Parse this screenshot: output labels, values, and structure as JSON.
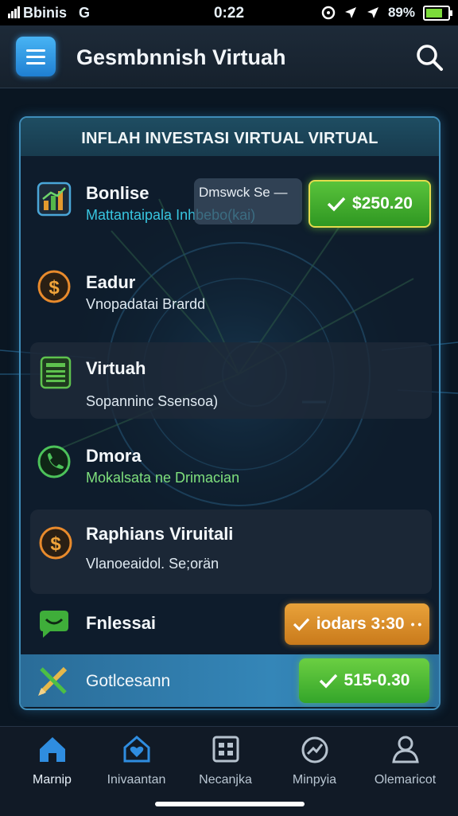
{
  "status_bar": {
    "carrier": "Bbinis",
    "network": "G",
    "time": "0:22",
    "battery": "89%",
    "battery_level": 0.89
  },
  "header": {
    "title": "Gesmbnnish Virtuah",
    "menu_icon": "hamburger-menu-icon",
    "search_icon": "search-icon"
  },
  "card": {
    "title": "INFLAH INVESTASI VIRTUAL VIRTUAL",
    "items": [
      {
        "title": "Bonlise",
        "subtitle": "Mattantaipala Inhbebo(kai)",
        "icon": "chart-icon",
        "tag": "Dmswck Se",
        "tag_suffix": "—",
        "action": "$250.20",
        "action_icon": "check-icon"
      },
      {
        "title": "Eadur",
        "subtitle": "Vnopadatai Brardd",
        "icon": "dollar-coin-icon"
      },
      {
        "title": "Virtuah",
        "subtitle": "Sopanninc Ssensoa)",
        "icon": "ledger-icon"
      },
      {
        "title": "Dmora",
        "subtitle": "Mokalsata ne Drimacian",
        "icon": "phone-icon"
      },
      {
        "title": "Raphians Viruitali",
        "subtitle": "Vlanoeaidol. Se;orän",
        "icon": "dollar-coin-icon"
      },
      {
        "title": "Fnlessai",
        "icon": "chat-bubble-icon",
        "action": "iodars 3:30",
        "action_suffix": "• •",
        "action_icon": "check-icon"
      },
      {
        "title": "Gotlcesann",
        "icon": "pencil-cross-icon",
        "action": "515-0.30",
        "action_icon": "check-icon"
      }
    ]
  },
  "nav": {
    "items": [
      {
        "label": "Marnip",
        "icon": "home-icon"
      },
      {
        "label": "Inivaantan",
        "icon": "house-heart-icon"
      },
      {
        "label": "Necanjka",
        "icon": "grid-box-icon"
      },
      {
        "label": "Minpyia",
        "icon": "chart-circle-icon"
      },
      {
        "label": "Olemaricot",
        "icon": "user-icon"
      }
    ]
  },
  "colors": {
    "accent_blue": "#3f8cb8",
    "positive_green": "#59c33b",
    "warning_orange": "#e9a23a",
    "cyan_text": "#38c6e0"
  }
}
